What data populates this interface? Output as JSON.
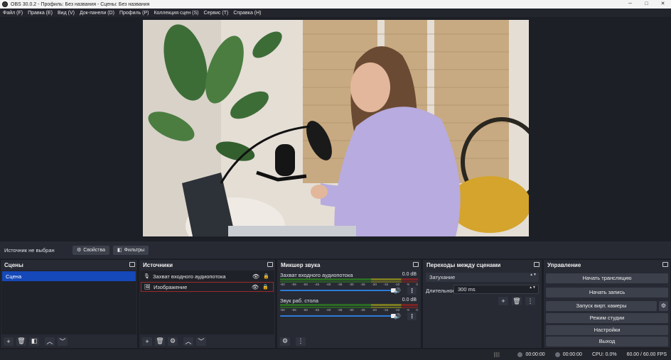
{
  "window": {
    "title": "OBS 30.0.2 - Профиль: Без названия - Сцены: Без названия",
    "minimize_icon": "─",
    "maximize_icon": "□",
    "close_icon": "✕"
  },
  "menu": [
    "Файл (F)",
    "Правка (E)",
    "Вид (V)",
    "Док-панели (D)",
    "Профиль (P)",
    "Коллекция сцен (S)",
    "Сервис (T)",
    "Справка (H)"
  ],
  "preview": {
    "description_icon": "photo-preview",
    "colors": {
      "wall": "#e7e1d8",
      "cane": "#c9ab84",
      "sweater": "#b9aee0",
      "hair": "#6b4a34",
      "plant": "#3f6f3a",
      "cushion": "#d7a82e"
    }
  },
  "source_bar": {
    "no_source": "Источник не выбран",
    "properties_icon": "⚙",
    "properties": "Свойства",
    "filters_icon": "◧",
    "filters": "Фильтры"
  },
  "scenes": {
    "title": "Сцены",
    "items": [
      "Сцена"
    ]
  },
  "sources": {
    "title": "Источники",
    "items": [
      {
        "label": "Захват входного аудиопотока",
        "icon": "🎙"
      },
      {
        "label": "Изображение",
        "icon": "🖼"
      }
    ]
  },
  "mixer": {
    "title": "Микшер звука",
    "ticks": [
      "-60",
      "-55",
      "-50",
      "-45",
      "-40",
      "-35",
      "-30",
      "-25",
      "-20",
      "-15",
      "-10",
      "-5",
      "0"
    ],
    "channels": [
      {
        "name": "Захват входного аудиопотока",
        "db": "0.0 dB",
        "level": 1.0
      },
      {
        "name": "Звук раб. стола",
        "db": "0.0 dB",
        "level": 1.0
      }
    ]
  },
  "transitions": {
    "title": "Переходы между сценами",
    "selected": "Затухание",
    "duration_label": "Длительность",
    "duration_value": "300 ms"
  },
  "controls": {
    "title": "Управление",
    "start_stream": "Начать трансляцию",
    "start_record": "Начать запись",
    "virtual_camera": "Запуск вирт. камеры",
    "studio_mode": "Режим студии",
    "settings": "Настройки",
    "exit": "Выход"
  },
  "icons": {
    "add": "+",
    "remove": "🗑",
    "props": "◧",
    "gear": "⚙",
    "up": "︿",
    "down": "﹀",
    "more": "⋮",
    "eye": "👁",
    "lock": "🔒",
    "speaker": "🔊",
    "updown": "▲▼"
  },
  "status": {
    "stream_time": "00:00:00",
    "record_time": "00:00:00",
    "cpu": "CPU: 0.0%",
    "fps": "60.00 / 60.00 FPS"
  }
}
